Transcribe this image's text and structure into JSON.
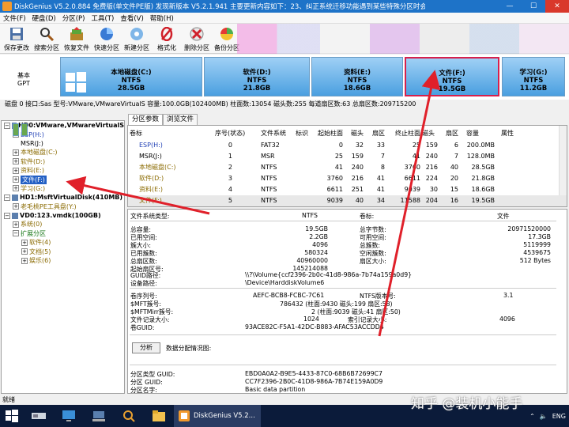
{
  "title": "DiskGenius V5.2.0.884 免费版(单文件PE版)  发现新版本 V5.2.1.941 主要更新内容如下：23、纠正系统迁移功能遇到某些特殊分区时会迁移失败的问题。",
  "window_controls": {
    "minimize": "—",
    "maximize": "☐",
    "close": "✕"
  },
  "menu": [
    "文件(F)",
    "硬盘(D)",
    "分区(P)",
    "工具(T)",
    "查看(V)",
    "帮助(H)"
  ],
  "toolbar": [
    {
      "label": "保存更改",
      "icon": "save-icon"
    },
    {
      "label": "搜索分区",
      "icon": "search-icon"
    },
    {
      "label": "恢复文件",
      "icon": "recover-icon"
    },
    {
      "label": "快速分区",
      "icon": "quick-partition-icon"
    },
    {
      "label": "新建分区",
      "icon": "new-partition-icon"
    },
    {
      "label": "格式化",
      "icon": "format-icon"
    },
    {
      "label": "删除分区",
      "icon": "delete-icon"
    },
    {
      "label": "备份分区",
      "icon": "backup-icon"
    }
  ],
  "diskmap": {
    "disk_label": "基本\nGPT",
    "partitions": [
      {
        "name": "本地磁盘(C:)",
        "fs": "NTFS",
        "size": "28.5GB"
      },
      {
        "name": "软件(D:)",
        "fs": "NTFS",
        "size": "21.8GB"
      },
      {
        "name": "资料(E:)",
        "fs": "NTFS",
        "size": "18.6GB"
      },
      {
        "name": "文件(F:)",
        "fs": "NTFS",
        "size": "19.5GB"
      },
      {
        "name": "学习(G:)",
        "fs": "NTFS",
        "size": "11.2GB"
      }
    ]
  },
  "disk_info": "磁盘 0 接口:Sas  型号:VMware,VMwareVirtualS  容量:100.0GB(102400MB)  柱面数:13054  磁头数:255  每道扇区数:63  总扇区数:209715200",
  "tree": [
    {
      "text": "HD0:VMware,VMwareVirtualS",
      "level": 0,
      "exp": "−",
      "type": "disk",
      "color": "",
      "bold": true
    },
    {
      "text": "ESP(H:)",
      "level": 1,
      "exp": "+",
      "type": "part",
      "color": "c-blue"
    },
    {
      "text": "MSR(J:)",
      "level": 1,
      "exp": "",
      "type": "part",
      "color": ""
    },
    {
      "text": "本地磁盘(C:)",
      "level": 1,
      "exp": "+",
      "type": "part",
      "color": "c-brown"
    },
    {
      "text": "软件(D:)",
      "level": 1,
      "exp": "+",
      "type": "part",
      "color": "c-brown"
    },
    {
      "text": "资料(E:)",
      "level": 1,
      "exp": "+",
      "type": "part",
      "color": "c-brown"
    },
    {
      "text": "文件(F:)",
      "level": 1,
      "exp": "+",
      "type": "part",
      "color": "",
      "selected": true
    },
    {
      "text": "学习(G:)",
      "level": 1,
      "exp": "+",
      "type": "part",
      "color": "c-brown"
    },
    {
      "text": "HD1:MsftVirtualDisk(410MB)",
      "level": 0,
      "exp": "−",
      "type": "disk",
      "color": "",
      "bold": true
    },
    {
      "text": "老毛桃PE工具盘(Y:)",
      "level": 1,
      "exp": "+",
      "type": "part",
      "color": "c-brown"
    },
    {
      "text": "VD0:123.vmdk(100GB)",
      "level": 0,
      "exp": "−",
      "type": "disk",
      "color": "",
      "bold": true
    },
    {
      "text": "系统(0)",
      "level": 1,
      "exp": "+",
      "type": "part",
      "color": "c-brown"
    },
    {
      "text": "扩展分区",
      "level": 1,
      "exp": "−",
      "type": "part",
      "color": "c-green"
    },
    {
      "text": "软件(4)",
      "level": 2,
      "exp": "+",
      "type": "part",
      "color": "c-brown"
    },
    {
      "text": "文档(5)",
      "level": 2,
      "exp": "+",
      "type": "part",
      "color": "c-brown"
    },
    {
      "text": "娱乐(6)",
      "level": 2,
      "exp": "+",
      "type": "part",
      "color": "c-brown"
    }
  ],
  "tabs": [
    "分区参数",
    "浏览文件"
  ],
  "table": {
    "headers": [
      "卷标",
      "序号(状态)",
      "文件系统",
      "标识",
      "起始柱面",
      "磁头",
      "扇区",
      "终止柱面",
      "磁头",
      "扇区",
      "容量",
      "属性"
    ],
    "rows": [
      [
        "ESP(H:)",
        "0",
        "FAT32",
        "",
        "0",
        "32",
        "33",
        "25",
        "159",
        "6",
        "200.0MB",
        ""
      ],
      [
        "MSR(J:)",
        "1",
        "MSR",
        "",
        "25",
        "159",
        "7",
        "41",
        "240",
        "7",
        "128.0MB",
        ""
      ],
      [
        "本地磁盘(C:)",
        "2",
        "NTFS",
        "",
        "41",
        "240",
        "8",
        "3760",
        "216",
        "40",
        "28.5GB",
        ""
      ],
      [
        "软件(D:)",
        "3",
        "NTFS",
        "",
        "3760",
        "216",
        "41",
        "6611",
        "224",
        "20",
        "21.8GB",
        ""
      ],
      [
        "资料(E:)",
        "4",
        "NTFS",
        "",
        "6611",
        "251",
        "41",
        "9039",
        "30",
        "15",
        "18.6GB",
        ""
      ],
      [
        "文件(F:)",
        "5",
        "NTFS",
        "",
        "9039",
        "40",
        "34",
        "11588",
        "204",
        "16",
        "19.5GB",
        ""
      ]
    ]
  },
  "details": {
    "fs_type_label": "文件系统类型:",
    "fs_type": "NTFS",
    "vol_label_label": "卷标:",
    "vol_label": "文件",
    "rows1": [
      [
        "总容量:",
        "19.5GB",
        "总字节数:",
        "20971520000"
      ],
      [
        "已用空间:",
        "2.2GB",
        "可用空间:",
        "17.3GB"
      ],
      [
        "簇大小:",
        "4096",
        "总簇数:",
        "5119999"
      ],
      [
        "已用簇数:",
        "580324",
        "空闲簇数:",
        "4539675"
      ],
      [
        "总扇区数:",
        "40960000",
        "扇区大小:",
        "512 Bytes"
      ],
      [
        "起始扇区号:",
        "145214088",
        "",
        ""
      ]
    ],
    "guid_path_label": "GUID路径:",
    "guid_path": "\\\\?\\Volume{ccf2396-2b0c-41d8-986a-7b74a159a0d9}",
    "device_path_label": "设备路径:",
    "device_path": "\\Device\\HarddiskVolume6",
    "serial_label": "卷序列号:",
    "serial": "AEFC-BCB8-FCBC-7C61",
    "ntfs_ver_label": "NTFS版本号:",
    "ntfs_ver": "3.1",
    "mft_label": "$MFT簇号:",
    "mft": "786432 (柱面:9430 磁头:199 扇区:58)",
    "mftmirr_label": "$MFTMirr簇号:",
    "mftmirr": "2 (柱面:9039 磁头:41 扇区:50)",
    "rec_size_label": "文件记录大小:",
    "rec_size": "1024",
    "idx_size_label": "索引记录大小:",
    "idx_size": "4096",
    "vol_guid_label": "卷GUID:",
    "vol_guid": "93ACE82C-F5A1-42DC-B883-AFAC53ACCDD4",
    "analyze": "分析",
    "dist_label": "数据分配情况图:",
    "type_guid_label": "分区类型 GUID:",
    "type_guid": "EBD0A0A2-B9E5-4433-87C0-68B6B72699C7",
    "part_guid_label": "分区 GUID:",
    "part_guid": "CC7F2396-2B0C-41D8-986A-7B74E159A0D9",
    "part_name_label": "分区名字:",
    "part_name": "Basic data partition"
  },
  "status": "就绪",
  "taskbar": {
    "app": "DiskGenius V5.2...",
    "lang": "ENG"
  },
  "watermark": "知乎 @装机小能手",
  "colors": {
    "title": "#1e73c8",
    "partition_top": "#9fd0f5",
    "partition_bottom": "#4a9fe0",
    "selected_border": "#d6204d",
    "arrow": "#e0202a"
  }
}
